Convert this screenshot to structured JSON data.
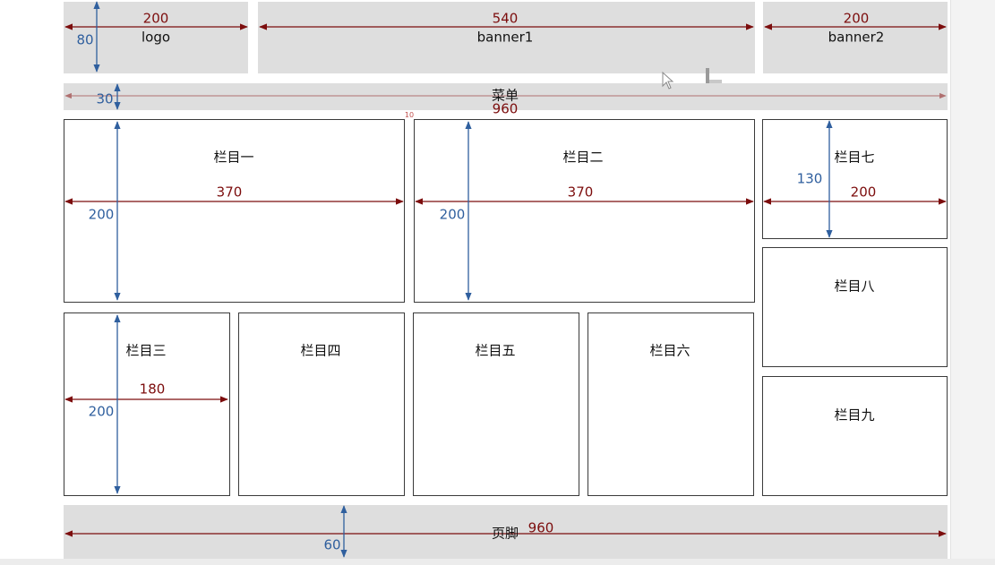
{
  "header": {
    "logo": {
      "label": "logo",
      "width": "200",
      "height": "80"
    },
    "banner1": {
      "label": "banner1",
      "width": "540"
    },
    "banner2": {
      "label": "banner2",
      "width": "200"
    }
  },
  "menu": {
    "label": "菜单",
    "width": "960",
    "height": "30"
  },
  "gap_label": "10",
  "columns": {
    "c1": {
      "label": "栏目一",
      "width": "370",
      "height": "200"
    },
    "c2": {
      "label": "栏目二",
      "width": "370",
      "height": "200"
    },
    "c3": {
      "label": "栏目三",
      "width": "180",
      "height": "200"
    },
    "c4": {
      "label": "栏目四"
    },
    "c5": {
      "label": "栏目五"
    },
    "c6": {
      "label": "栏目六"
    },
    "c7": {
      "label": "栏目七",
      "width": "200",
      "height": "130"
    },
    "c8": {
      "label": "栏目八"
    },
    "c9": {
      "label": "栏目九"
    }
  },
  "footer": {
    "label": "页脚",
    "width": "960",
    "height": "60"
  },
  "colors": {
    "width_arrow": "#7c0d0d",
    "height_arrow": "#2f5f9e",
    "block_gray": "#dedede",
    "box_border": "#3a3a3a"
  }
}
